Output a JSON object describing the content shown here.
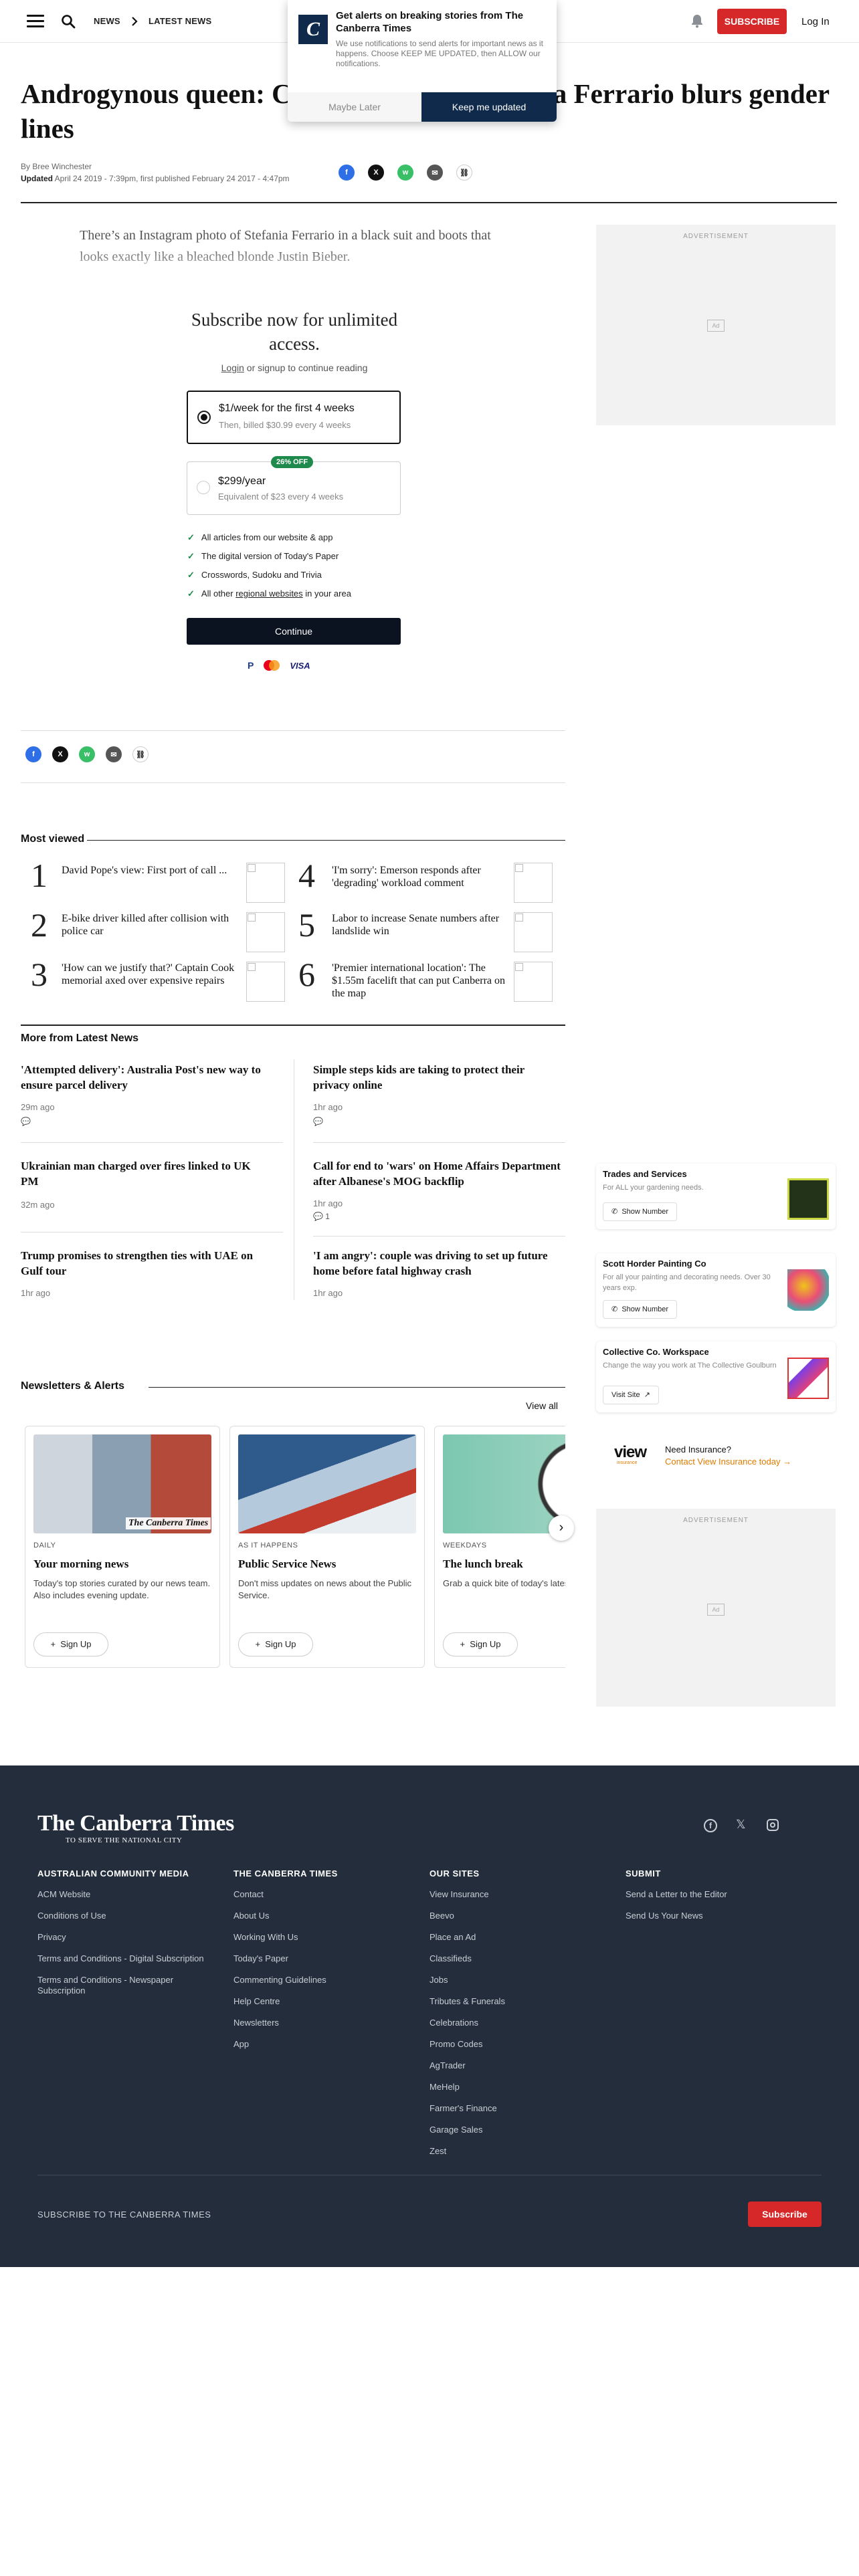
{
  "header": {
    "crumb1": "NEWS",
    "crumb2": "LATEST NEWS",
    "subscribe": "SUBSCRIBE",
    "login": "Log In"
  },
  "article": {
    "title_left": "Androgynous queen: C",
    "title_right": "a Ferrario blurs gender",
    "title_line2": "lines",
    "byline": "By Bree Winchester",
    "updated_label": "Updated",
    "updated": "April 24 2019 - 7:39pm, first published February 24 2017 - 4:47pm",
    "lede": "There’s an Instagram photo of Stefania Ferrario in a black suit and boots that looks exactly like a bleached blonde Justin Bieber."
  },
  "paywall": {
    "title": "Subscribe now for unlimited access.",
    "login": "Login",
    "login_rest": " or signup to continue reading",
    "option1_main": "$1/week for the first 4 weeks",
    "option1_sub": "Then, billed $30.99 every 4 weeks",
    "option2_badge": "26% OFF",
    "option2_main": "$299/year",
    "option2_sub": "Equivalent of $23 every 4 weeks",
    "features": [
      "All articles from our website & app",
      "The digital version of Today's Paper",
      "Crosswords, Sudoku and Trivia"
    ],
    "feature4_pre": "All other ",
    "feature4_link": "regional websites",
    "feature4_post": " in your area",
    "continue": "Continue",
    "pay1": "P",
    "pay3": "VISA"
  },
  "ads": {
    "label": "ADVERTISEMENT",
    "placeholder": "Ad"
  },
  "most_viewed": {
    "heading": "Most viewed",
    "items": [
      {
        "num": "1",
        "title": "David Pope's view: First port of call ..."
      },
      {
        "num": "2",
        "title": "E-bike driver killed after collision with police car"
      },
      {
        "num": "3",
        "title": "'How can we justify that?' Captain Cook memorial axed over expensive repairs"
      },
      {
        "num": "4",
        "title": "'I'm sorry': Emerson responds after 'degrading' workload comment"
      },
      {
        "num": "5",
        "title": "Labor to increase Senate numbers after landslide win"
      },
      {
        "num": "6",
        "title": "'Premier international location': The $1.55m facelift that can put Canberra on the map"
      }
    ]
  },
  "more_news": {
    "heading": "More from Latest News",
    "left": [
      {
        "title": "'Attempted delivery': Australia Post's new way to ensure parcel delivery",
        "meta": "29m ago"
      },
      {
        "title": "Ukrainian man charged over fires linked to UK PM",
        "meta": "32m ago"
      },
      {
        "title": "Trump promises to strengthen ties with UAE on Gulf tour",
        "meta": "1hr ago"
      }
    ],
    "right": [
      {
        "title": "Simple steps kids are taking to protect their privacy online",
        "meta": "1hr ago"
      },
      {
        "title": "Call for end to 'wars' on Home Affairs Department after Albanese's MOG backflip",
        "meta": "1hr ago",
        "comments": "1"
      },
      {
        "title": "'I am angry': couple was driving to set up future home before fatal highway crash",
        "meta": "1hr ago"
      }
    ]
  },
  "businesses": [
    {
      "title": "Trades and Services",
      "desc": "For ALL your gardening needs.",
      "button": "Show Number"
    },
    {
      "title": "Scott Horder Painting Co",
      "desc": "For all your painting and decorating needs. Over 30 years exp.",
      "button": "Show Number"
    },
    {
      "title": "Collective Co. Workspace",
      "desc": "Change the way you work at The Collective Goulburn",
      "button": "Visit Site"
    }
  ],
  "insurance": {
    "logo": "view",
    "logo_sub": "insurance",
    "q": "Need Insurance?",
    "link": "Contact View Insurance today"
  },
  "newsletters": {
    "heading": "Newsletters & Alerts",
    "view_all": "View all",
    "cards": [
      {
        "label": "DAILY",
        "title": "Your morning news",
        "desc": "Today's top stories curated by our news team. Also includes evening update.",
        "button": "Sign Up",
        "logo": "The Canberra Times"
      },
      {
        "label": "AS IT HAPPENS",
        "title": "Public Service News",
        "desc": "Don't miss updates on news about the Public Service.",
        "button": "Sign Up"
      },
      {
        "label": "WEEKDAYS",
        "title": "The lunch break",
        "desc": "Grab a quick bite of today's latest news from around the region and the nation.",
        "button": "Sign Up"
      }
    ]
  },
  "notification": {
    "logo": "C",
    "title": "Get alerts on breaking stories from The Canberra Times",
    "body": "We use notifications to send alerts for important news as it happens. Choose KEEP ME UPDATED, then ALLOW our notifications.",
    "later": "Maybe Later",
    "keep": "Keep me updated"
  },
  "footer": {
    "logo": "The Canberra Times",
    "tagline": "TO SERVE THE NATIONAL CITY",
    "cols": [
      {
        "heading": "AUSTRALIAN COMMUNITY MEDIA",
        "links": [
          "ACM Website",
          "Conditions of Use",
          "Privacy",
          "Terms and Conditions - Digital Subscription",
          "Terms and Conditions - Newspaper Subscription"
        ]
      },
      {
        "heading": "THE CANBERRA TIMES",
        "links": [
          "Contact",
          "About Us",
          "Working With Us",
          "Today's Paper",
          "Commenting Guidelines",
          "Help Centre",
          "Newsletters",
          "App"
        ]
      },
      {
        "heading": "OUR SITES",
        "links": [
          "View Insurance",
          "Beevo",
          "Place an Ad",
          "Classifieds",
          "Jobs",
          "Tributes & Funerals",
          "Celebrations",
          "Promo Codes",
          "AgTrader",
          "MeHelp",
          "Farmer's Finance",
          "Garage Sales",
          "Zest"
        ]
      },
      {
        "heading": "SUBMIT",
        "links": [
          "Send a Letter to the Editor",
          "Send Us Your News"
        ]
      }
    ],
    "subscribe_label": "SUBSCRIBE TO THE CANBERRA TIMES",
    "subscribe_btn": "Subscribe"
  },
  "colors": {
    "brand_red": "#d62828",
    "footer_bg": "#232d3b",
    "notif_blue": "#0f2a4a",
    "green": "#1e8a4c"
  }
}
